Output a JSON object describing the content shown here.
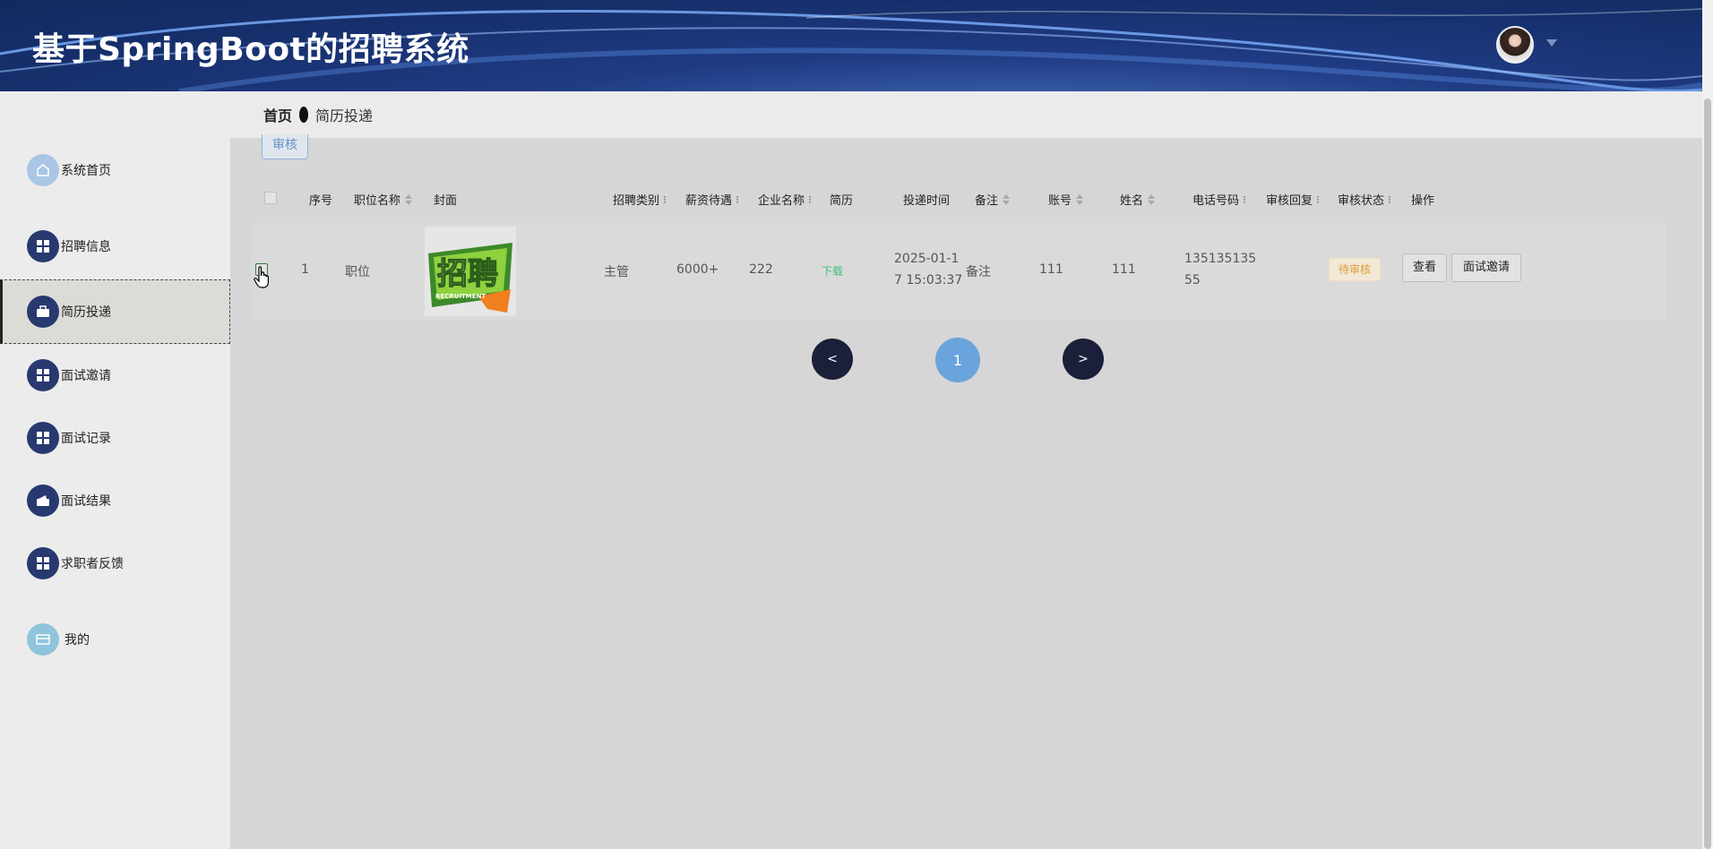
{
  "app": {
    "title": "基于SpringBoot的招聘系统"
  },
  "sidebar": {
    "items": [
      {
        "label": "系统首页",
        "icon": "home-icon"
      },
      {
        "label": "招聘信息",
        "icon": "grid-icon"
      },
      {
        "label": "简历投递",
        "icon": "briefcase-icon",
        "active": true
      },
      {
        "label": "面试邀请",
        "icon": "grid-icon"
      },
      {
        "label": "面试记录",
        "icon": "grid-icon"
      },
      {
        "label": "面试结果",
        "icon": "wallet-icon"
      },
      {
        "label": "求职者反馈",
        "icon": "grid-icon"
      },
      {
        "label": "我的",
        "icon": "card-icon"
      }
    ]
  },
  "breadcrumb": {
    "home": "首页",
    "current": "简历投递"
  },
  "toolbar": {
    "review_label": "审核"
  },
  "table": {
    "columns": [
      "序号",
      "职位名称",
      "封面",
      "招聘类别",
      "薪资待遇",
      "企业名称",
      "简历",
      "投递时间",
      "备注",
      "账号",
      "姓名",
      "电话号码",
      "审核回复",
      "审核状态",
      "操作"
    ],
    "rows": [
      {
        "index": "1",
        "position": "职位",
        "cover_text": "招聘",
        "cover_sub": "RECRUITMENT",
        "category": "主管",
        "salary": "6000+",
        "company": "222",
        "resume": "下载",
        "time_line1": "2025-01-1",
        "time_line2": "7 15:03:37",
        "note": "备注",
        "account": "111",
        "name": "111",
        "phone_line1": "135135135",
        "phone_line2": "55",
        "reply": "",
        "status": "待审核",
        "actions": {
          "view": "查看",
          "invite": "面试邀请"
        }
      }
    ]
  },
  "pagination": {
    "prev": "<",
    "current": "1",
    "next": ">"
  },
  "colors": {
    "header": "#1f3b84",
    "accent": "#6aa4dc",
    "status": "#e09a37",
    "download": "#3fbf7f"
  }
}
